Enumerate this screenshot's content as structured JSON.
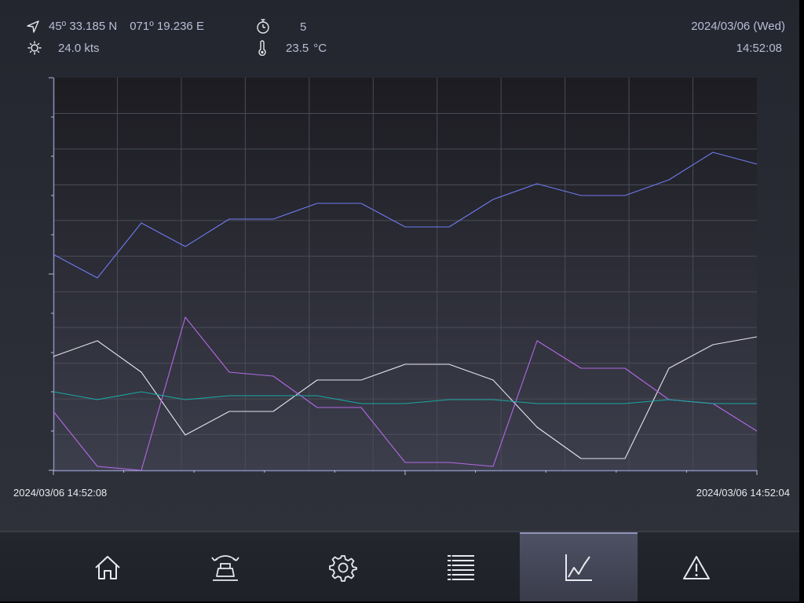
{
  "status": {
    "latitude": "45º 33.185 N",
    "longitude": "071º 19.236 E",
    "wind_speed": "24.0 kts",
    "timer_value": "5",
    "temperature_value": "23.5",
    "temperature_unit": "°C",
    "date": "2024/03/06 (Wed)",
    "time": "14:52:08"
  },
  "icons": {
    "navigation": "navigation-arrow-icon",
    "wind": "wind-sun-icon",
    "timer": "stopwatch-icon",
    "temperature": "thermometer-icon"
  },
  "chart_data": {
    "type": "line",
    "x_start_label": "2024/03/06 14:52:08",
    "x_end_label": "2024/03/06 14:52:04",
    "y_range": [
      0,
      100
    ],
    "grid": true,
    "series": [
      {
        "color": "#6f7bf0",
        "values": [
          55,
          49,
          63,
          57,
          64,
          64,
          68,
          68,
          62,
          62,
          69,
          73,
          70,
          70,
          74,
          81,
          78
        ]
      },
      {
        "color": "#e4e4ec",
        "values": [
          29,
          33,
          25,
          9,
          15,
          15,
          23,
          23,
          27,
          27,
          23,
          11,
          3,
          3,
          26,
          32,
          34
        ]
      },
      {
        "color": "#b468e6",
        "values": [
          15,
          1,
          0,
          39,
          25,
          24,
          16,
          16,
          2,
          2,
          1,
          33,
          26,
          26,
          18,
          17,
          10
        ]
      },
      {
        "color": "#1aa7a3",
        "values": [
          20,
          18,
          20,
          18,
          19,
          19,
          19,
          17,
          17,
          18,
          18,
          17,
          17,
          17,
          18,
          17,
          17
        ]
      }
    ]
  },
  "nav": {
    "items": [
      {
        "name": "home-icon",
        "active": false
      },
      {
        "name": "ship-tilt-icon",
        "active": false
      },
      {
        "name": "gear-icon",
        "active": false
      },
      {
        "name": "list-icon",
        "active": false
      },
      {
        "name": "line-chart-icon",
        "active": true
      },
      {
        "name": "warning-icon",
        "active": false
      }
    ]
  }
}
